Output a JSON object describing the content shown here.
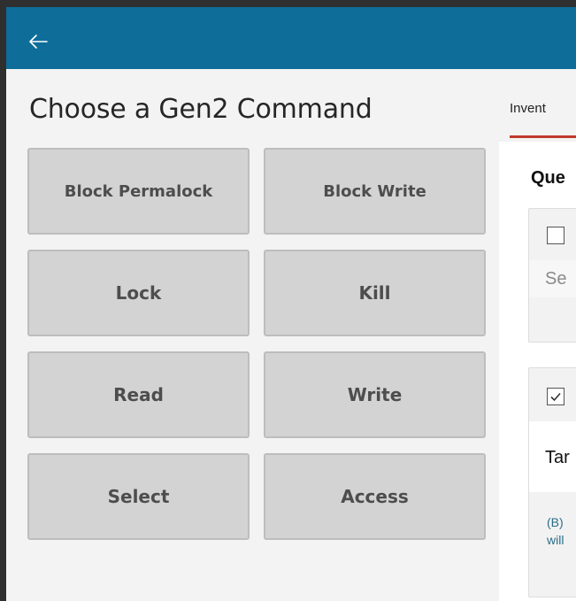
{
  "header": {
    "back_icon": "back-arrow-icon"
  },
  "left": {
    "title": "Choose a Gen2 Command",
    "commands": [
      {
        "label": "Block Permalock"
      },
      {
        "label": "Block Write"
      },
      {
        "label": "Lock"
      },
      {
        "label": "Kill"
      },
      {
        "label": "Read"
      },
      {
        "label": "Write"
      },
      {
        "label": "Select"
      },
      {
        "label": "Access"
      }
    ]
  },
  "right": {
    "tab_label": "Invent",
    "section_heading": "Que",
    "card1": {
      "checkbox_checked": false,
      "field_placeholder": "Se"
    },
    "card2": {
      "checkbox_checked": true,
      "field_value": "Tar",
      "note_line1": "(B)",
      "note_line2": "will"
    }
  },
  "colors": {
    "titlebar": "#0e6d99",
    "button_bg": "#d3d3d3",
    "tab_underline": "#c0392b",
    "note_text": "#2c6e8a"
  }
}
